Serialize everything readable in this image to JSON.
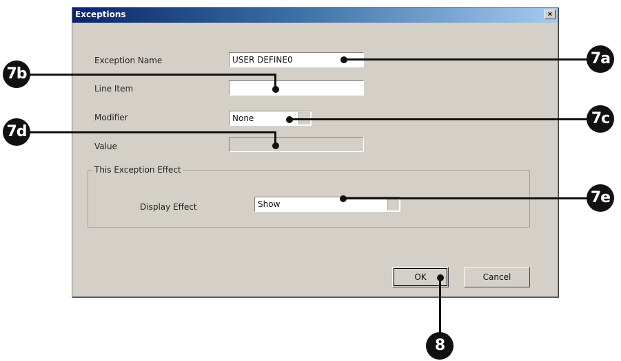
{
  "dialog": {
    "title": "Exceptions",
    "close_label": "×",
    "exception_name_label": "Exception Name",
    "exception_name_value": "USER DEFINE0",
    "line_item_label": "Line Item",
    "line_item_value": "",
    "modifier_label": "Modifier",
    "modifier_value": "None",
    "value_label": "Value",
    "value_value": "",
    "group_title": "This Exception Effect",
    "display_effect_label": "Display Effect",
    "display_effect_value": "Show",
    "ok_label": "OK",
    "cancel_label": "Cancel"
  },
  "callouts": {
    "c7a": "7a",
    "c7b": "7b",
    "c7c": "7c",
    "c7d": "7d",
    "c7e": "7e",
    "c8": "8"
  }
}
